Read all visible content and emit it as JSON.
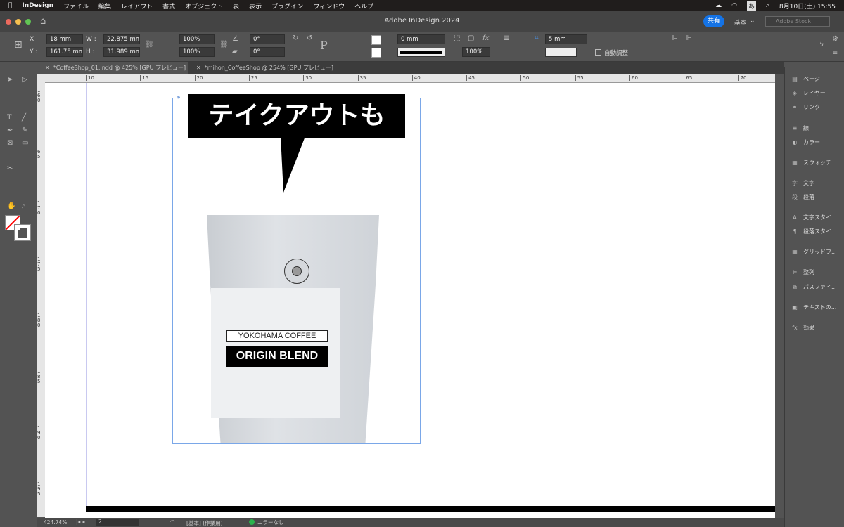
{
  "menubar": {
    "app": "InDesign",
    "items": [
      "ファイル",
      "編集",
      "レイアウト",
      "書式",
      "オブジェクト",
      "表",
      "表示",
      "プラグイン",
      "ウィンドウ",
      "ヘルプ"
    ],
    "ime": "あ",
    "datetime": "8月10日(土)  15:55"
  },
  "titlebar": {
    "title": "Adobe InDesign 2024",
    "share": "共有",
    "workspace": "基本",
    "stock_placeholder": "Adobe Stock"
  },
  "control": {
    "x": "18 mm",
    "y": "161.75 mm",
    "w": "22.875 mm",
    "h": "31.989 mm",
    "scale_x": "100%",
    "scale_y": "100%",
    "rotate": "0°",
    "shear": "0°",
    "stroke_weight": "0 mm",
    "opacity": "100%",
    "gap": "5 mm",
    "auto_fit": "自動調整",
    "labels": {
      "x": "X :",
      "y": "Y :",
      "w": "W :",
      "h": "H :"
    }
  },
  "tabs": [
    {
      "label": "*CoffeeShop_01.indd @ 425% [GPU プレビュー]",
      "active": true
    },
    {
      "label": "*mihon_CoffeeShop @ 254% [GPU プレビュー]",
      "active": false
    }
  ],
  "ruler": {
    "h": [
      "10",
      "15",
      "20",
      "25",
      "30",
      "35",
      "40",
      "45",
      "50",
      "55",
      "60",
      "65",
      "70"
    ],
    "v": [
      "160",
      "165",
      "170",
      "175",
      "180",
      "185",
      "190",
      "195"
    ]
  },
  "artwork": {
    "bubble_text": "テイクアウトも",
    "label_top": "YOKOHAMA COFFEE",
    "label_bottom": "ORIGIN BLEND"
  },
  "panels": [
    {
      "icon": "pages",
      "label": "ページ"
    },
    {
      "icon": "layers",
      "label": "レイヤー"
    },
    {
      "icon": "links",
      "label": "リンク"
    },
    {
      "icon": "stroke",
      "label": "線"
    },
    {
      "icon": "color",
      "label": "カラー"
    },
    {
      "icon": "swatches",
      "label": "スウォッチ"
    },
    {
      "icon": "character",
      "label": "文字"
    },
    {
      "icon": "paragraph",
      "label": "段落"
    },
    {
      "icon": "char-styles",
      "label": "文字スタイ..."
    },
    {
      "icon": "para-styles",
      "label": "段落スタイ..."
    },
    {
      "icon": "grid",
      "label": "グリッドフ..."
    },
    {
      "icon": "align",
      "label": "整列"
    },
    {
      "icon": "pathfinder",
      "label": "パスファイ..."
    },
    {
      "icon": "text-wrap",
      "label": "テキストの..."
    },
    {
      "icon": "effects",
      "label": "効果"
    }
  ],
  "status": {
    "zoom": "424.74%",
    "page": "2",
    "style": "[基本] (作業用)",
    "preflight": "エラーなし",
    "preflight_color": "#2bb24c"
  },
  "colors": {
    "accent": "#1473e6",
    "selection": "#7aa7e8"
  }
}
